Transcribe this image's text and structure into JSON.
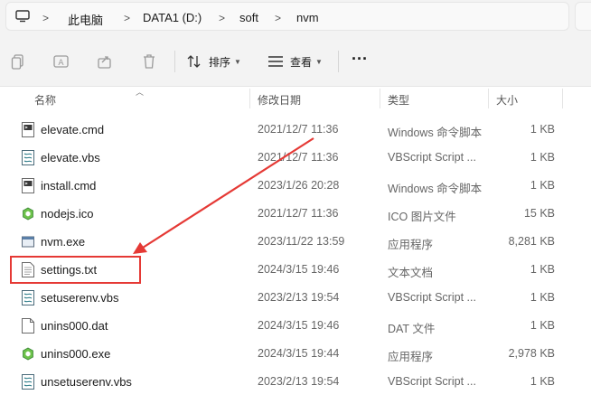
{
  "address_bar": {
    "crumbs": [
      "此电脑",
      "DATA1 (D:)",
      "soft",
      "nvm"
    ],
    "icon": "computer-monitor-icon"
  },
  "toolbar": {
    "icons": [
      "copy-icon",
      "rename-icon",
      "share-icon",
      "delete-icon"
    ],
    "sort_label": "排序",
    "view_label": "查看",
    "more_label": "···"
  },
  "columns": {
    "name": "名称",
    "date": "修改日期",
    "type": "类型",
    "size": "大小"
  },
  "files": [
    {
      "name": "elevate.cmd",
      "date": "2021/12/7 11:36",
      "type": "Windows 命令脚本",
      "size": "1 KB",
      "icon": "cmd-file-icon"
    },
    {
      "name": "elevate.vbs",
      "date": "2021/12/7 11:36",
      "type": "VBScript Script ...",
      "size": "1 KB",
      "icon": "vbs-file-icon"
    },
    {
      "name": "install.cmd",
      "date": "2023/1/26 20:28",
      "type": "Windows 命令脚本",
      "size": "1 KB",
      "icon": "cmd-file-icon"
    },
    {
      "name": "nodejs.ico",
      "date": "2021/12/7 11:36",
      "type": "ICO 图片文件",
      "size": "15 KB",
      "icon": "nodejs-hex-icon"
    },
    {
      "name": "nvm.exe",
      "date": "2023/11/22 13:59",
      "type": "应用程序",
      "size": "8,281 KB",
      "icon": "exe-window-icon"
    },
    {
      "name": "settings.txt",
      "date": "2024/3/15 19:46",
      "type": "文本文档",
      "size": "1 KB",
      "icon": "text-file-icon"
    },
    {
      "name": "setuserenv.vbs",
      "date": "2023/2/13 19:54",
      "type": "VBScript Script ...",
      "size": "1 KB",
      "icon": "vbs-file-icon"
    },
    {
      "name": "unins000.dat",
      "date": "2024/3/15 19:46",
      "type": "DAT 文件",
      "size": "1 KB",
      "icon": "blank-file-icon"
    },
    {
      "name": "unins000.exe",
      "date": "2024/3/15 19:44",
      "type": "应用程序",
      "size": "2,978 KB",
      "icon": "installer-hex-icon"
    },
    {
      "name": "unsetuserenv.vbs",
      "date": "2023/2/13 19:54",
      "type": "VBScript Script ...",
      "size": "1 KB",
      "icon": "vbs-file-icon"
    }
  ],
  "annotation": {
    "highlighted_file": "settings.txt",
    "color": "#e53935"
  }
}
